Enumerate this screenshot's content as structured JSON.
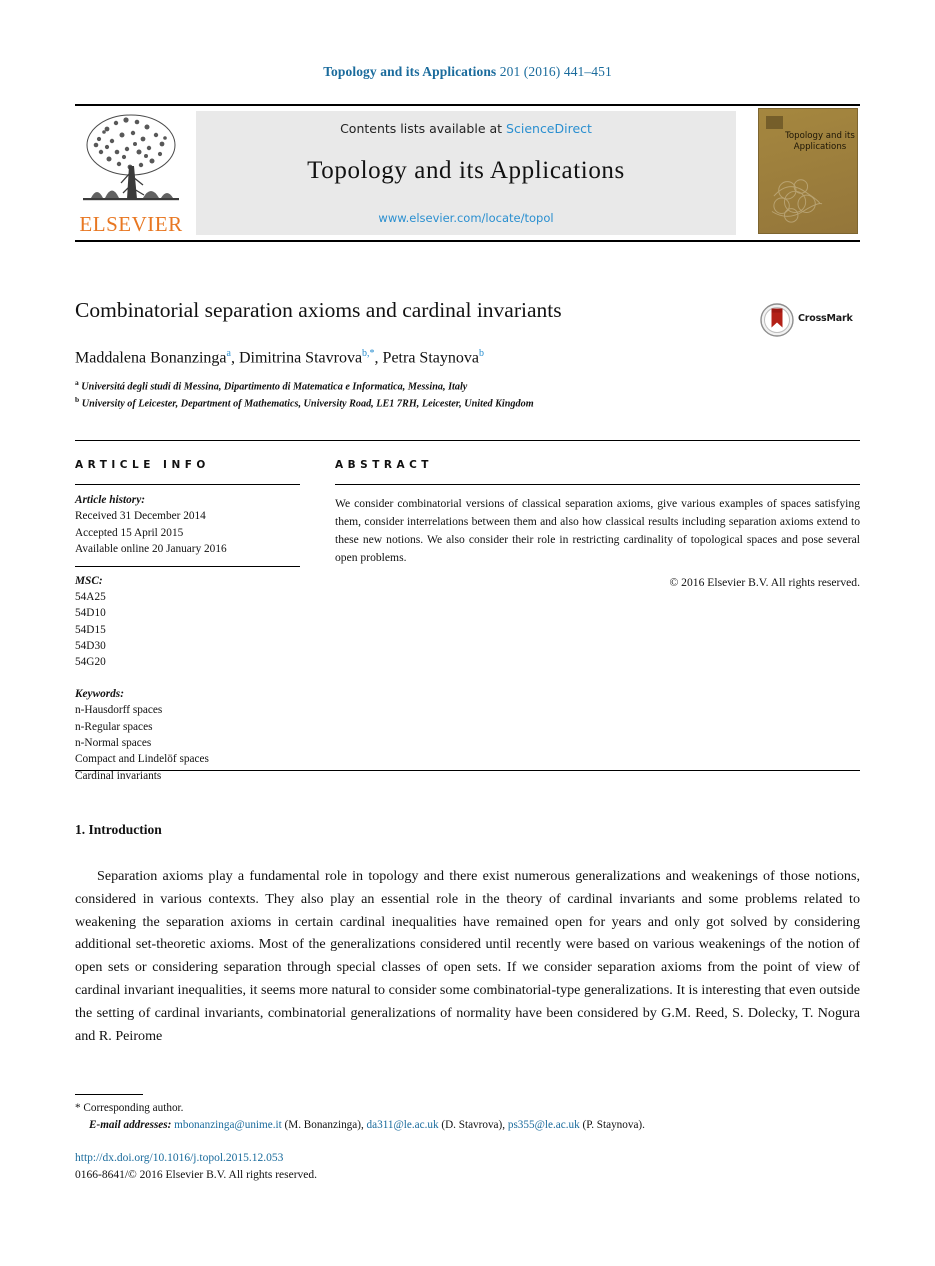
{
  "running_head": {
    "journal": "Topology and its Applications",
    "citation": "201 (2016) 441–451"
  },
  "masthead": {
    "contents_prefix": "Contents lists available at ",
    "sciencedirect": "ScienceDirect",
    "journal_title": "Topology and its Applications",
    "journal_url": "www.elsevier.com/locate/topol",
    "publisher": "ELSEVIER",
    "cover_title": "Topology and its Applications"
  },
  "article": {
    "title": "Combinatorial separation axioms and cardinal invariants",
    "crossmark_label": "CrossMark",
    "authors_html": "Maddalena Bonanzinga<sup>a</sup>, Dimitrina Stavrova<sup>b,*</sup>, Petra Staynova<sup>b</sup>",
    "affiliations_html": "<sup>a</sup> Universitá degli studi di Messina, Dipartimento di Matematica e Informatica, Messina, Italy<br><sup>b</sup> University of Leicester, Department of Mathematics, University Road, LE1 7RH, Leicester, United Kingdom"
  },
  "info": {
    "heading": "ARTICLE INFO",
    "history_label": "Article history:",
    "history": [
      "Received 31 December 2014",
      "Accepted 15 April 2015",
      "Available online 20 January 2016"
    ],
    "msc_label": "MSC:",
    "msc": [
      "54A25",
      "54D10",
      "54D15",
      "54D30",
      "54G20"
    ],
    "keywords_label": "Keywords:",
    "keywords": [
      "n-Hausdorff spaces",
      "n-Regular spaces",
      "n-Normal spaces",
      "Compact and Lindelöf spaces",
      "Cardinal invariants"
    ]
  },
  "abstract": {
    "heading": "ABSTRACT",
    "body": "We consider combinatorial versions of classical separation axioms, give various examples of spaces satisfying them, consider interrelations between them and also how classical results including separation axioms extend to these new notions. We also consider their role in restricting cardinality of topological spaces and pose several open problems.",
    "copyright": "© 2016 Elsevier B.V. All rights reserved."
  },
  "introduction": {
    "heading": "1. Introduction",
    "paragraph": "Separation axioms play a fundamental role in topology and there exist numerous generalizations and weakenings of those notions, considered in various contexts. They also play an essential role in the theory of cardinal invariants and some problems related to weakening the separation axioms in certain cardinal inequalities have remained open for years and only got solved by considering additional set-theoretic axioms. Most of the generalizations considered until recently were based on various weakenings of the notion of open sets or considering separation through special classes of open sets. If we consider separation axioms from the point of view of cardinal invariant inequalities, it seems more natural to consider some combinatorial-type generalizations. It is interesting that even outside the setting of cardinal invariants, combinatorial generalizations of normality have been considered by G.M. Reed, S. Dolecky, T. Nogura and R. Peirome"
  },
  "footer": {
    "corresponding": "* Corresponding author.",
    "email_label": "E-mail addresses:",
    "emails": [
      {
        "address": "mbonanzinga@unime.it",
        "owner": "(M. Bonanzinga),"
      },
      {
        "address": "da311@le.ac.uk",
        "owner": "(D. Stavrova),"
      },
      {
        "address": "ps355@le.ac.uk",
        "owner": "(P. Staynova)."
      }
    ],
    "doi": "http://dx.doi.org/10.1016/j.topol.2015.12.053",
    "issn_line": "0166-8641/© 2016 Elsevier B.V. All rights reserved."
  },
  "colors": {
    "link": "#1a6b9c",
    "sciencedirect": "#2a8fd0",
    "elsevier_orange": "#E87722",
    "cover_tan": "#9a7e3e"
  }
}
